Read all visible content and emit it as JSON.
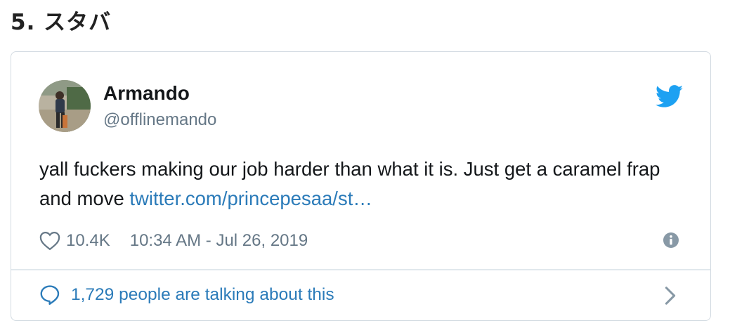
{
  "heading": "5. スタバ",
  "tweet": {
    "author_name": "Armando",
    "author_handle": "@offlinemando",
    "text": "yall fuckers making our job harder than what it is. Just get a caramel frap and move ",
    "link_text": "twitter.com/princepesaa/st…",
    "like_count": "10.4K",
    "timestamp": "10:34 AM - Jul 26, 2019",
    "conversation": "1,729 people are talking about this"
  },
  "icons": {
    "avatar": "avatar",
    "brand": "twitter-bird-icon",
    "like": "heart-icon",
    "info": "info-icon",
    "reply": "comment-bubble-icon",
    "chevron": "chevron-right-icon"
  },
  "colors": {
    "twitter_blue": "#1da1f2",
    "link_blue": "#2b7bb9",
    "secondary_text": "#657786",
    "border": "#d3dbe2"
  }
}
